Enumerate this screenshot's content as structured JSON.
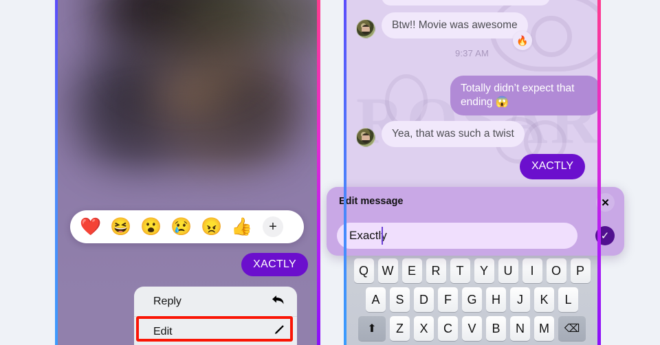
{
  "left_phone": {
    "reaction_bar": {
      "name": "emoji-reaction-bar",
      "emojis": [
        "❤️",
        "😆",
        "😮",
        "😢",
        "😠",
        "👍"
      ],
      "add_label": "+"
    },
    "outgoing_message": "XACTLY",
    "context_menu": {
      "items": [
        {
          "label": "Reply",
          "icon": "↰",
          "icon_name": "reply-arrow-icon",
          "highlighted": false
        },
        {
          "label": "Edit",
          "icon": "✎",
          "icon_name": "pencil-icon",
          "highlighted": true
        }
      ]
    }
  },
  "right_phone": {
    "watermark_text": "ROSARI",
    "messages": [
      {
        "id": "m1",
        "direction": "incoming",
        "text": "Btw!! Movie was awesome",
        "reaction": "🔥"
      },
      {
        "id": "m2",
        "direction": "outgoing",
        "text": "Totally didn’t expect that ending 😱"
      },
      {
        "id": "m3",
        "direction": "incoming",
        "text": "Yea, that was such a twist"
      },
      {
        "id": "m4",
        "direction": "outgoing",
        "text": "XACTLY"
      }
    ],
    "timestamp": "9:37 AM",
    "edit_dialog": {
      "title": "Edit message",
      "close_label": "✕",
      "input_value": "Exactly",
      "input_placeholder": "Edit message",
      "confirm_label": "✓"
    },
    "keyboard": {
      "row1": [
        "Q",
        "W",
        "E",
        "R",
        "T",
        "Y",
        "U",
        "I",
        "O",
        "P"
      ],
      "row2": [
        "A",
        "S",
        "D",
        "F",
        "G",
        "H",
        "J",
        "K",
        "L"
      ],
      "row3_shift": "⬆",
      "row3": [
        "Z",
        "X",
        "C",
        "V",
        "B",
        "N",
        "M"
      ],
      "row3_backspace": "⌫"
    }
  },
  "colors": {
    "accent_purple": "#6b0fcd",
    "bubble_out": "#b18ad6",
    "bubble_in": "#f1e8fb",
    "chat_bg": "#ded0ef",
    "dialog_bg": "#c9a8e6",
    "highlight_red": "#fa1505",
    "page_bg": "#eff2f7"
  }
}
